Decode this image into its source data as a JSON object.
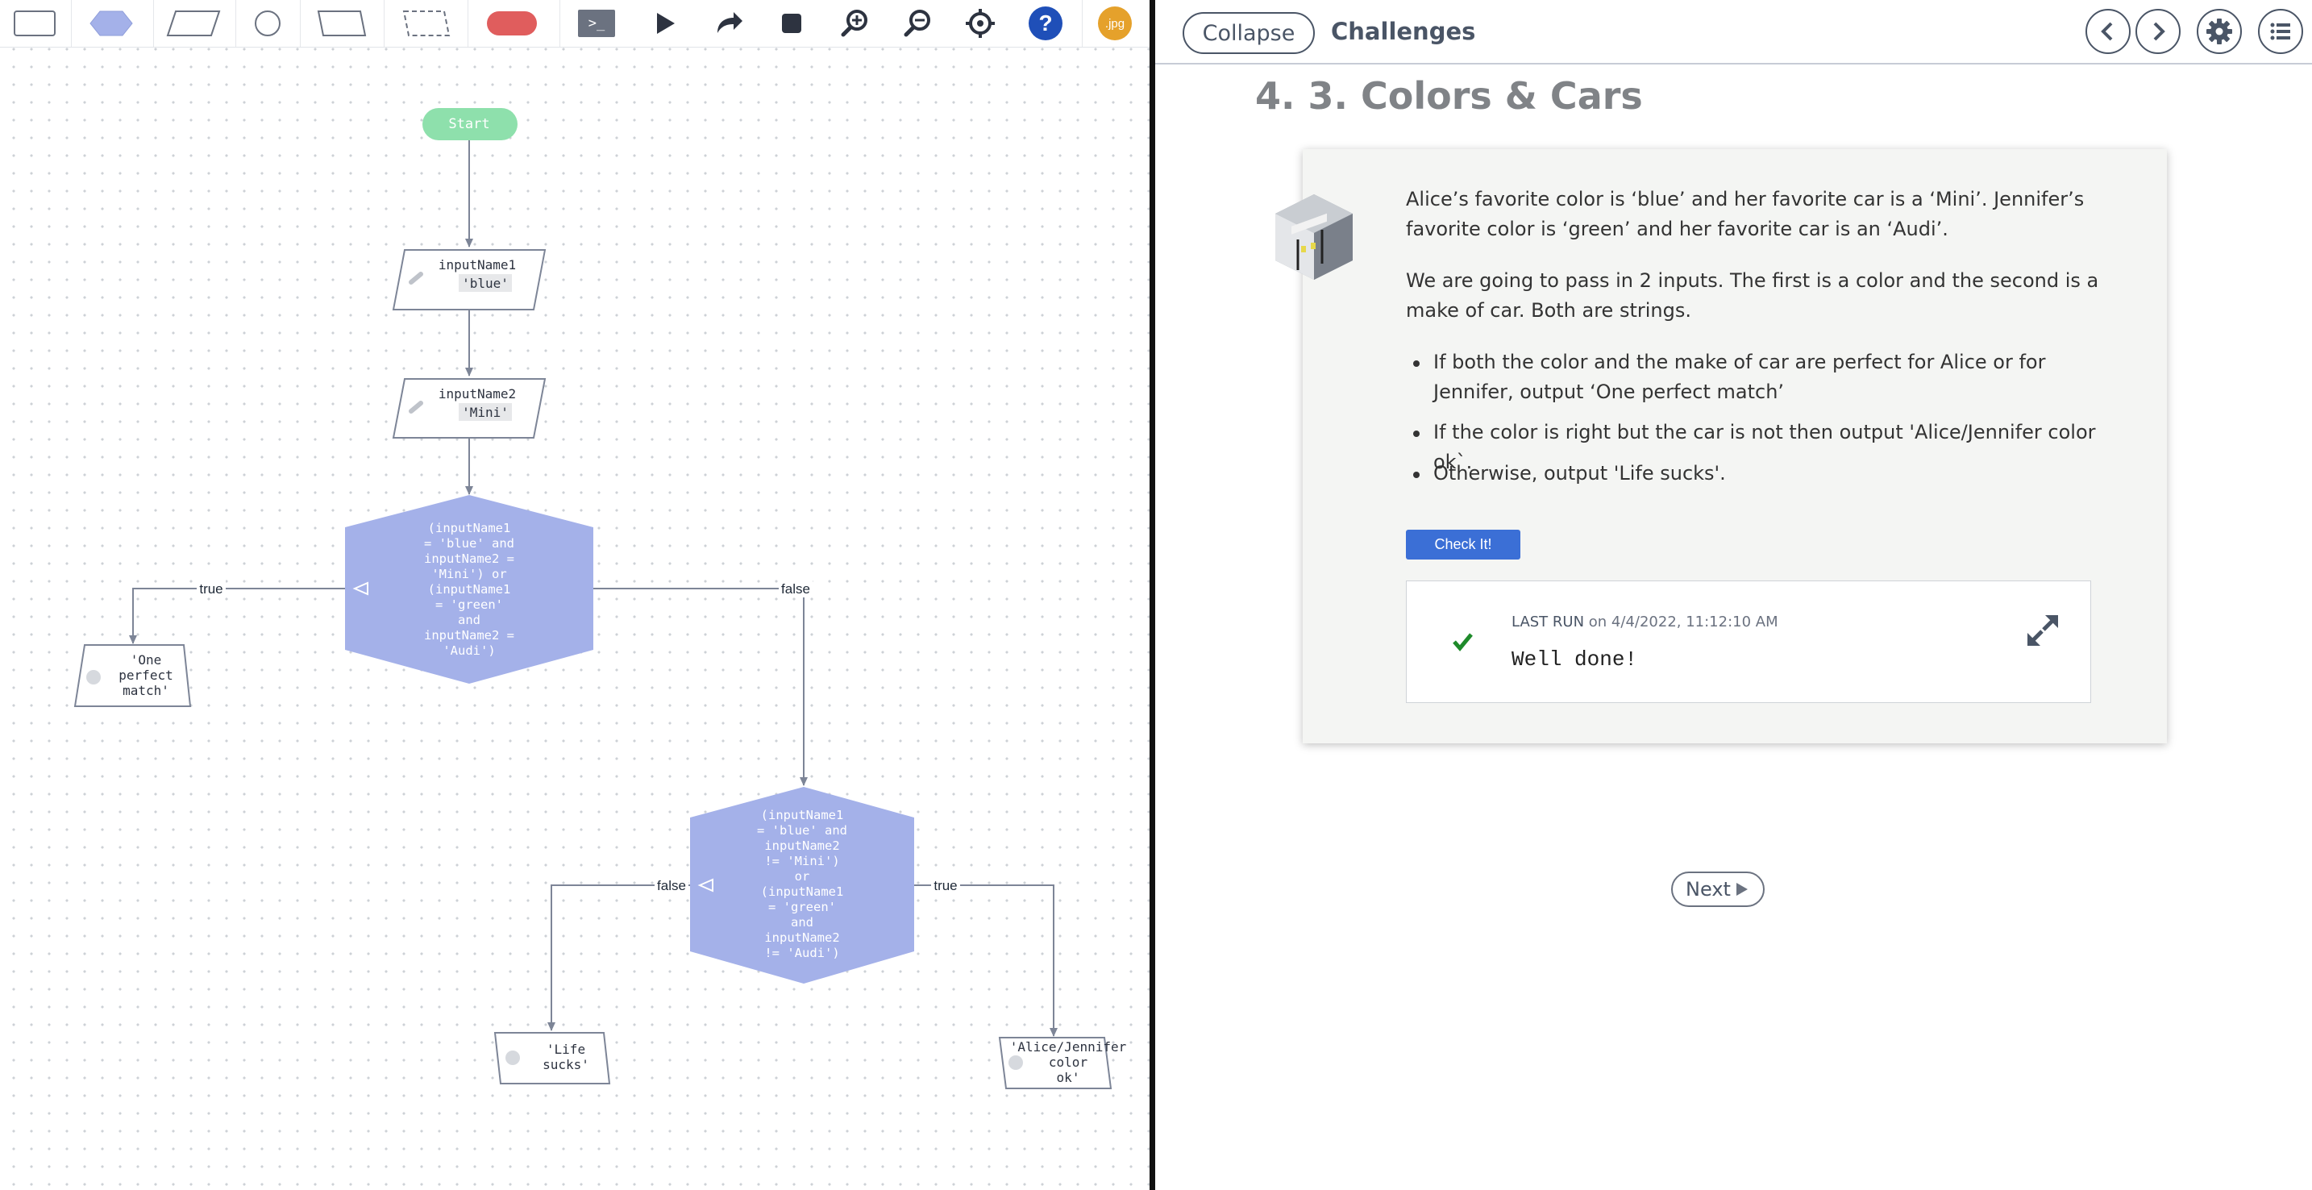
{
  "toolbar": {
    "icons": [
      "rectangle-icon",
      "hexagon-icon",
      "parallelogram-icon",
      "circle-icon",
      "manual-input-icon",
      "dashed-box-icon",
      "terminal-shape-icon",
      "console-icon",
      "play-icon",
      "redo-icon",
      "stop-icon",
      "zoom-in-icon",
      "zoom-out-icon",
      "center-icon",
      "help-icon",
      "export-jpg-icon"
    ],
    "console_label": ">_",
    "help_label": "?",
    "jpg_label": ".jpg"
  },
  "flowchart": {
    "start": "Start",
    "input1": {
      "name": "inputName1",
      "value": "'blue'"
    },
    "input2": {
      "name": "inputName2",
      "value": "'Mini'"
    },
    "decision1": [
      "(inputName1",
      "= 'blue' and",
      "inputName2 =",
      "'Mini') or",
      "(inputName1",
      "= 'green'",
      "and",
      "inputName2 =",
      "'Audi')"
    ],
    "decision1_true": "true",
    "decision1_false": "false",
    "output1": [
      "'One",
      "perfect",
      "match'"
    ],
    "decision2": [
      "(inputName1",
      "= 'blue' and",
      "inputName2",
      "!= 'Mini')",
      "or",
      "(inputName1",
      "= 'green'",
      "and",
      "inputName2",
      "!= 'Audi')"
    ],
    "decision2_false": "false",
    "decision2_true": "true",
    "output2": [
      "'Life",
      "sucks'"
    ],
    "output3": [
      "'Alice/Jennifer",
      "color",
      "ok'"
    ]
  },
  "panel": {
    "collapse_label": "Collapse",
    "header_title": "Challenges",
    "title": "4. 3. Colors & Cars",
    "para1": "Alice’s favorite color is ‘blue’ and her favorite car is a ‘Mini’. Jennifer’s favorite color is ‘green’ and her favorite car is an ‘Audi’.",
    "para2": "We are going to pass in 2 inputs. The first is a color and the second is a make of car. Both are strings.",
    "bullets": [
      "If both the color and the make of car are perfect for Alice or for Jennifer, output ‘One perfect match’",
      "If the color is right but the car is not then output 'Alice/Jennifer color ok`.",
      "Otherwise, output 'Life sucks'."
    ],
    "check_label": "Check It!",
    "last_run_label": "LAST RUN",
    "last_run_time": "on 4/4/2022, 11:12:10 AM",
    "result_text": "Well done!",
    "next_label": "Next"
  },
  "colors": {
    "decision_fill": "#a4b1e9",
    "start_fill": "#8ee0ac",
    "accent_blue": "#3b6fd6",
    "help_blue": "#1f4fb8",
    "jpg_orange": "#e5a12b",
    "stop_red": "#e05d5d"
  }
}
